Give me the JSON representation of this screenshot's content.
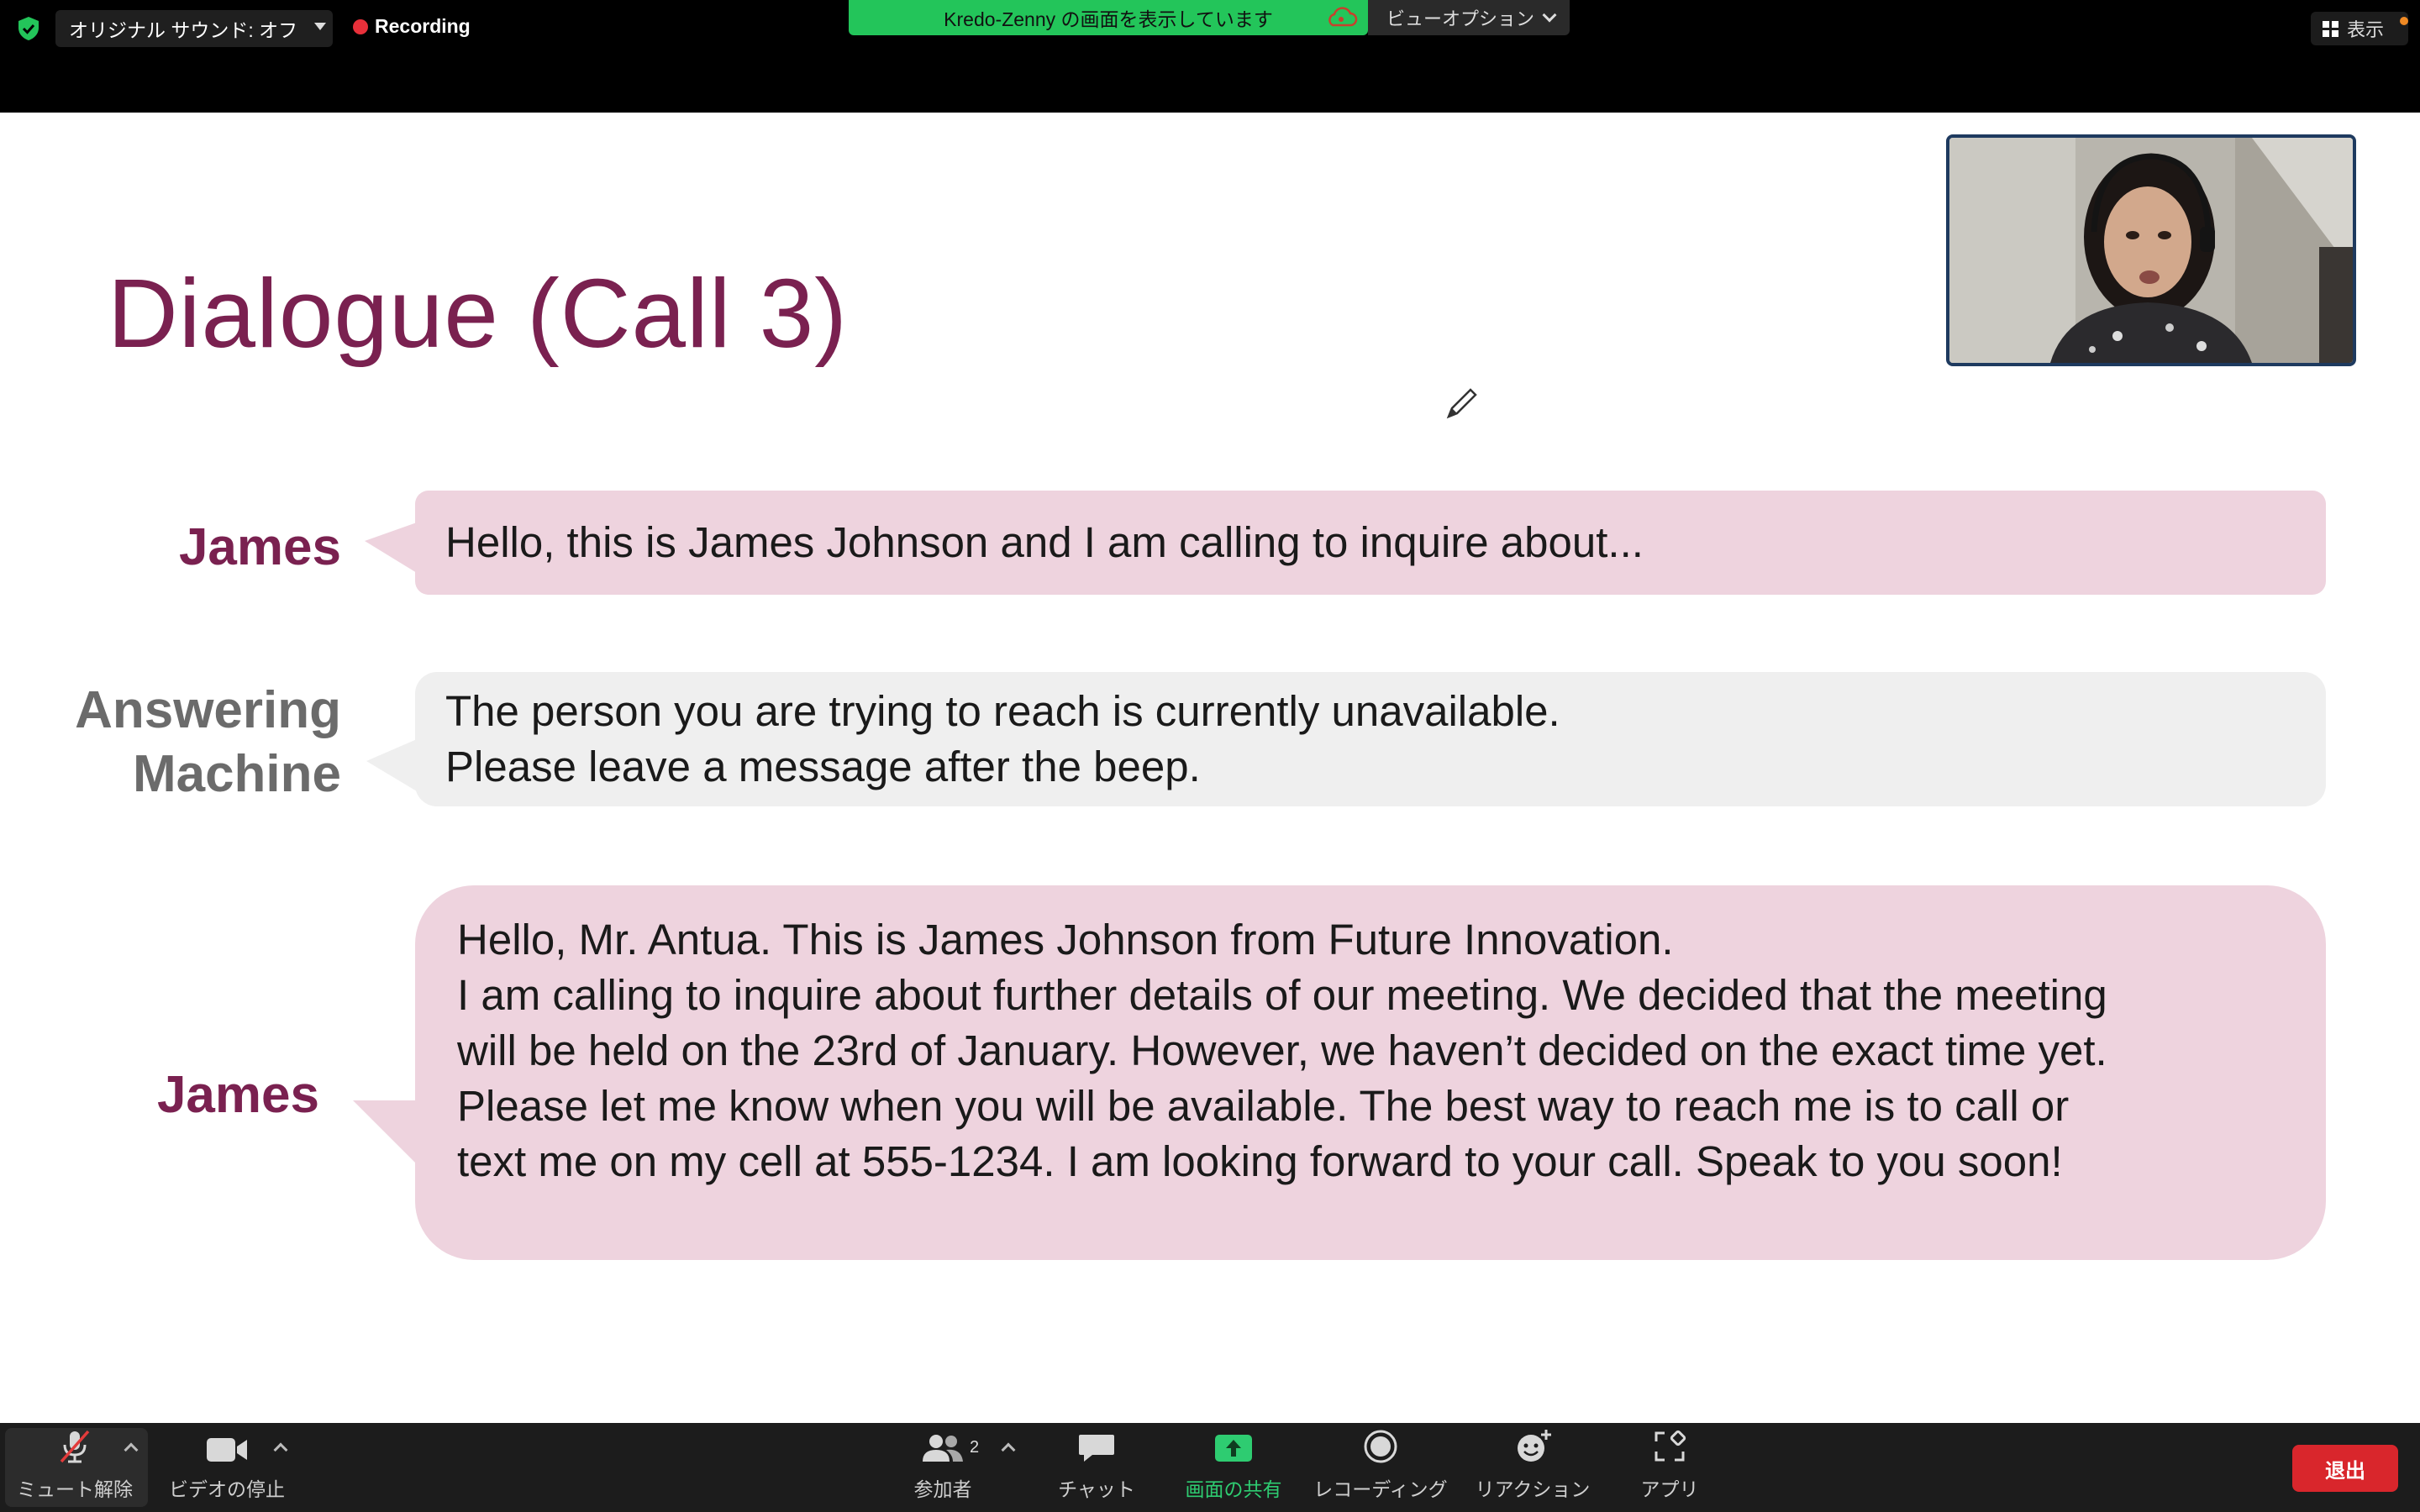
{
  "topbar": {
    "audio_label": "オリジナル サウンド: オフ",
    "recording_label": "Recording",
    "share_banner": "Kredo-Zenny の画面を表示しています",
    "view_options": "ビューオプション",
    "display_label": "表示",
    "colors": {
      "share_green": "#23c55a",
      "record_red": "#e8303a"
    }
  },
  "slide": {
    "title": "Dialogue (Call 3)",
    "dialogue": [
      {
        "speaker": "James",
        "lines": [
          "Hello, this is James Johnson and I am calling to inquire about..."
        ]
      },
      {
        "speaker_lines": [
          "Answering",
          "Machine"
        ],
        "lines": [
          "The person you are trying to reach is currently unavailable.",
          "Please leave a message after the beep."
        ]
      },
      {
        "speaker": "James",
        "lines": [
          "Hello, Mr. Antua. This is James Johnson from Future Innovation.",
          "I am calling to inquire about further details of our meeting. We decided that the meeting",
          "will be held on the 23rd of January. However, we haven’t decided on the exact time yet.",
          "Please let me know when you will be available. The best way to reach me is to call or",
          "text me on my cell at 555-1234. I am looking forward to your call. Speak to you soon!"
        ]
      }
    ],
    "colors": {
      "title": "#7a2150",
      "pink_bubble": "#eed3de",
      "gray_bubble": "#efefef"
    }
  },
  "toolbar": {
    "mute": "ミュート解除",
    "video": "ビデオの停止",
    "participants": "参加者",
    "participants_count": "2",
    "chat": "チャット",
    "share": "画面の共有",
    "record": "レコーディング",
    "reactions": "リアクション",
    "apps": "アプリ",
    "leave": "退出"
  }
}
